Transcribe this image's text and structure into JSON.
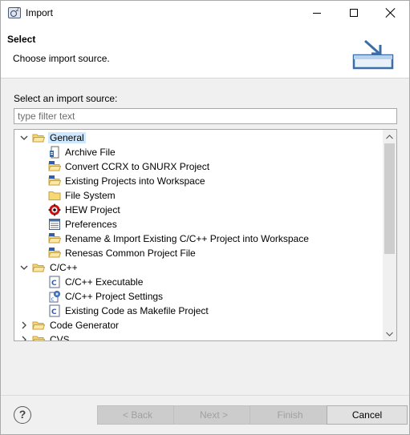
{
  "window": {
    "title": "Import"
  },
  "header": {
    "title": "Select",
    "description": "Choose import source."
  },
  "source_label": "Select an import source:",
  "filter": {
    "placeholder": "type filter text",
    "value": ""
  },
  "tree": {
    "rows": [
      {
        "label": "General",
        "level": 0,
        "expanded": true,
        "selected": true,
        "icon": "folder-open-icon"
      },
      {
        "label": "Archive File",
        "level": 1,
        "icon": "archive-file-icon"
      },
      {
        "label": "Convert CCRX to GNURX Project",
        "level": 1,
        "icon": "project-folder-icon"
      },
      {
        "label": "Existing Projects into Workspace",
        "level": 1,
        "icon": "project-folder-icon"
      },
      {
        "label": "File System",
        "level": 1,
        "icon": "folder-icon"
      },
      {
        "label": "HEW Project",
        "level": 1,
        "icon": "hew-icon"
      },
      {
        "label": "Preferences",
        "level": 1,
        "icon": "preferences-icon"
      },
      {
        "label": "Rename & Import Existing C/C++ Project into Workspace",
        "level": 1,
        "icon": "project-folder-icon"
      },
      {
        "label": "Renesas Common Project File",
        "level": 1,
        "icon": "project-folder-icon"
      },
      {
        "label": "C/C++",
        "level": 0,
        "expanded": true,
        "icon": "folder-open-icon"
      },
      {
        "label": "C/C++ Executable",
        "level": 1,
        "icon": "c-file-icon"
      },
      {
        "label": "C/C++ Project Settings",
        "level": 1,
        "icon": "settings-icon"
      },
      {
        "label": "Existing Code as Makefile Project",
        "level": 1,
        "icon": "c-file-icon"
      },
      {
        "label": "Code Generator",
        "level": 0,
        "expanded": false,
        "icon": "folder-open-icon"
      },
      {
        "label": "CVS",
        "level": 0,
        "expanded": false,
        "icon": "folder-open-icon"
      }
    ]
  },
  "buttons": {
    "back": "< Back",
    "next": "Next >",
    "finish": "Finish",
    "cancel": "Cancel",
    "help": "?"
  }
}
